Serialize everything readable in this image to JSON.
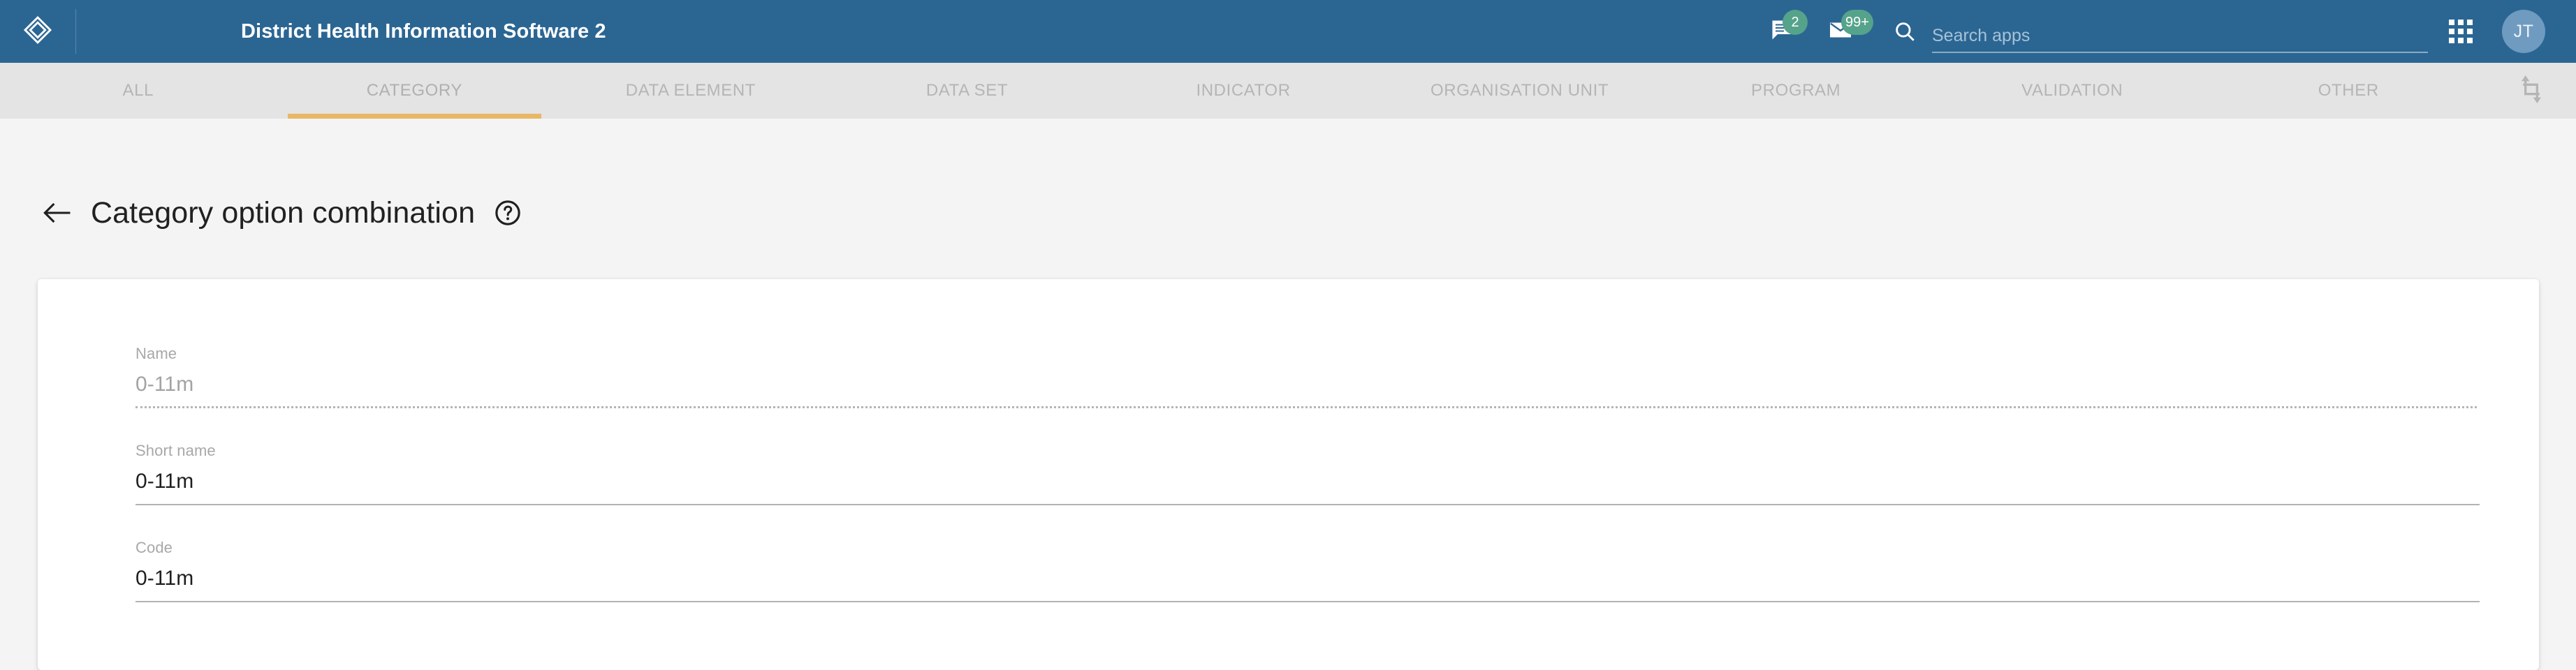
{
  "header": {
    "logo_icon": "dhis2-diamond-logo-icon",
    "app_title": "District Health Information Software 2",
    "messages": {
      "icon": "message-icon",
      "badge": "2"
    },
    "mail": {
      "icon": "mail-icon",
      "badge": "99+"
    },
    "search": {
      "icon": "search-icon",
      "placeholder": "Search apps",
      "value": ""
    },
    "apps_menu_icon": "apps-grid-icon",
    "avatar": {
      "initials": "JT",
      "color": "#6f9bc0"
    }
  },
  "tabs": {
    "items": [
      {
        "label": "ALL",
        "active": false
      },
      {
        "label": "CATEGORY",
        "active": true
      },
      {
        "label": "DATA ELEMENT",
        "active": false
      },
      {
        "label": "DATA SET",
        "active": false
      },
      {
        "label": "INDICATOR",
        "active": false
      },
      {
        "label": "ORGANISATION UNIT",
        "active": false
      },
      {
        "label": "PROGRAM",
        "active": false
      },
      {
        "label": "VALIDATION",
        "active": false
      },
      {
        "label": "OTHER",
        "active": false
      }
    ],
    "end_icon": "crop-resize-icon",
    "active_indicator_color": "#eab765"
  },
  "page": {
    "back_icon": "back-arrow-icon",
    "title": "Category option combination",
    "help_icon": "help-circle-icon"
  },
  "form": {
    "fields": [
      {
        "label": "Name",
        "value": "0-11m",
        "disabled": true
      },
      {
        "label": "Short name",
        "value": "0-11m",
        "disabled": false
      },
      {
        "label": "Code",
        "value": "0-11m",
        "disabled": false
      }
    ]
  },
  "colors": {
    "header_blue": "#2b6693",
    "tabbar_grey": "#e4e4e4",
    "page_background": "#f4f4f4",
    "badge_green": "#55a38a",
    "accent_orange": "#eab765"
  }
}
